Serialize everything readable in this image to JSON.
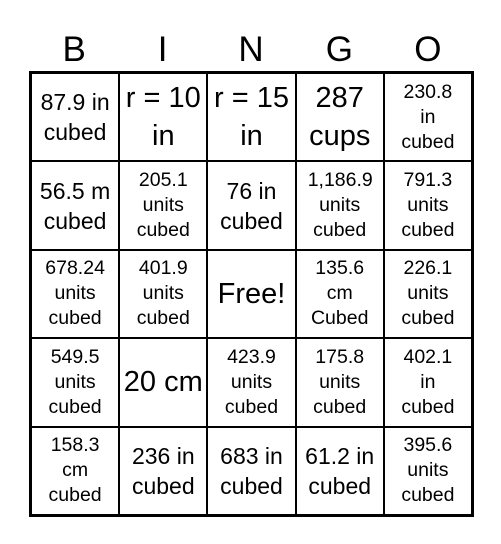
{
  "header": [
    "B",
    "I",
    "N",
    "G",
    "O"
  ],
  "cells": [
    [
      "87.9 in cubed",
      "r = 10 in",
      "r = 15 in",
      "287 cups",
      "230.8 in cubed"
    ],
    [
      "56.5 m cubed",
      "205.1 units cubed",
      "76 in cubed",
      "1,186.9 units cubed",
      "791.3 units cubed"
    ],
    [
      "678.24 units cubed",
      "401.9 units cubed",
      "Free!",
      "135.6 cm Cubed",
      "226.1 units cubed"
    ],
    [
      "549.5 units cubed",
      "20 cm",
      "423.9 units cubed",
      "175.8 units cubed",
      "402.1 in cubed"
    ],
    [
      "158.3 cm cubed",
      "236 in cubed",
      "683 in cubed",
      "61.2 in cubed",
      "395.6 units cubed"
    ]
  ]
}
